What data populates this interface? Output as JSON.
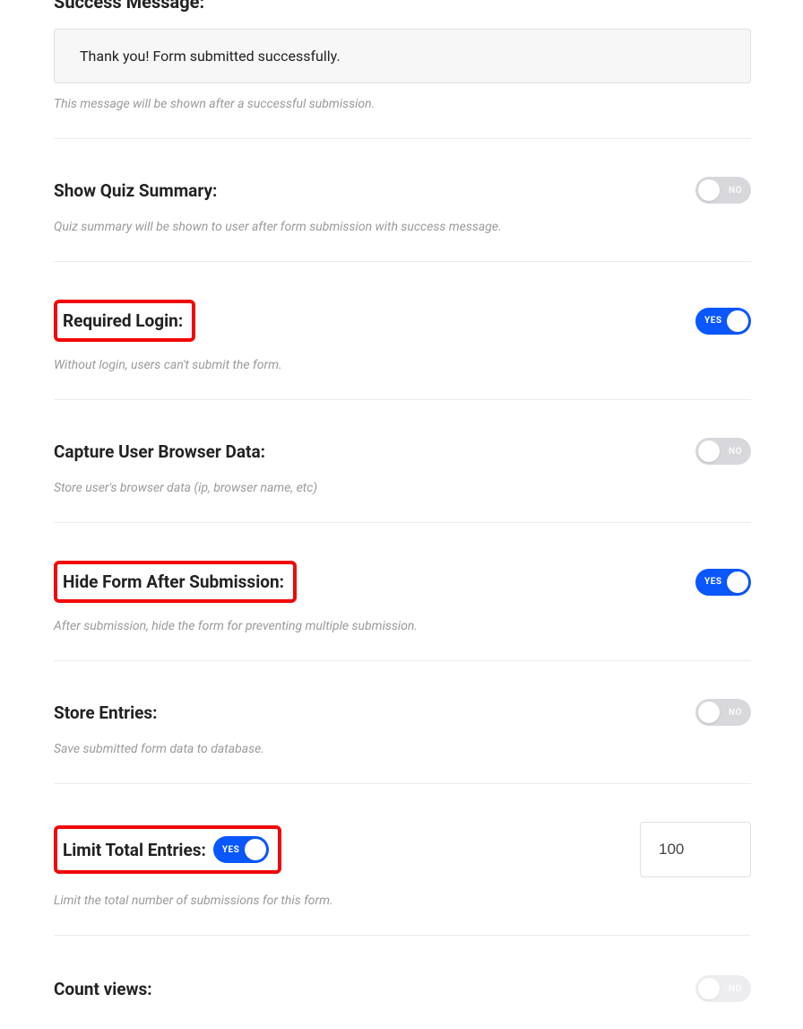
{
  "successMessage": {
    "heading": "Success Message:",
    "value": "Thank you! Form submitted successfully.",
    "helper": "This message will be shown after a successful submission."
  },
  "toggleText": {
    "yes": "YES",
    "no": "NO"
  },
  "rows": {
    "quizSummary": {
      "label": "Show Quiz Summary:",
      "helper": "Quiz summary will be shown to user after form submission with success message."
    },
    "requiredLogin": {
      "label": "Required Login:",
      "helper": "Without login, users can't submit the form."
    },
    "browserData": {
      "label": "Capture User Browser Data:",
      "helper": "Store user's browser data (ip, browser name, etc)"
    },
    "hideAfter": {
      "label": "Hide Form After Submission:",
      "helper": "After submission, hide the form for preventing multiple submission."
    },
    "storeEntries": {
      "label": "Store Entries:",
      "helper": "Save submitted form data to database."
    },
    "limitEntries": {
      "label": "Limit Total Entries:",
      "value": "100",
      "helper": "Limit the total number of submissions for this form."
    },
    "countViews": {
      "label": "Count views:"
    }
  }
}
